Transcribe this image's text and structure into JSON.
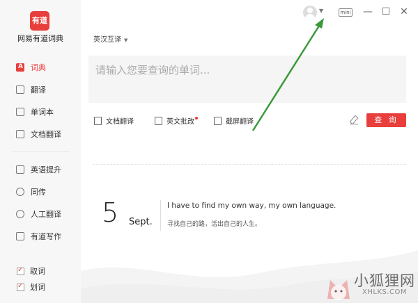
{
  "app": {
    "logo_text": "有道",
    "name": "网易有道词典"
  },
  "sidebar": {
    "items": [
      {
        "label": "词典",
        "icon": "dictionary-icon",
        "active": true
      },
      {
        "label": "翻译",
        "icon": "translate-icon"
      },
      {
        "label": "单词本",
        "icon": "wordbook-icon"
      },
      {
        "label": "文档翻译",
        "icon": "document-icon"
      },
      {
        "label": "英语提升",
        "icon": "play-icon"
      },
      {
        "label": "同传",
        "icon": "headphone-icon"
      },
      {
        "label": "人工翻译",
        "icon": "person-icon"
      },
      {
        "label": "有道写作",
        "icon": "edit-check-icon"
      }
    ],
    "checks": [
      {
        "label": "取词",
        "checked": true
      },
      {
        "label": "划词",
        "checked": true
      }
    ]
  },
  "topbar": {
    "mini_label": "mini",
    "minimize": "—",
    "maximize": "☐",
    "close": "✕"
  },
  "main": {
    "lang_select": "英汉互译",
    "search_placeholder": "请输入您要查询的单词...",
    "tools": [
      {
        "label": "文档翻译",
        "icon": "doc-translate-icon"
      },
      {
        "label": "英文批改",
        "icon": "check-doc-icon",
        "badge": true
      },
      {
        "label": "截屏翻译",
        "icon": "screenshot-icon"
      }
    ],
    "query_button": "查 询"
  },
  "daily": {
    "day": "5",
    "month": "Sept.",
    "quote_en": "I have to find my own way, my own language.",
    "quote_cn": "寻找自己的路，活出自己的人生。"
  },
  "watermark": {
    "title": "小狐狸网",
    "url": "XHLKS.COM"
  },
  "colors": {
    "accent": "#e83e3c",
    "arrow": "#3a9a3a"
  }
}
